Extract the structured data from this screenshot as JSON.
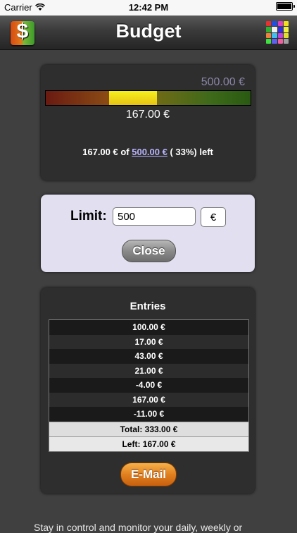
{
  "status_bar": {
    "carrier": "Carrier",
    "time": "12:42 PM"
  },
  "navbar": {
    "title": "Budget",
    "app_icon_glyph": "$",
    "grid_colors": [
      "#e83030",
      "#2050e0",
      "#e040c0",
      "#f0e020",
      "#30b030",
      "#f0f0f0",
      "#3030e0",
      "#f0f040",
      "#f08040",
      "#40c0f0",
      "#c040e0",
      "#e0e030",
      "#40e040",
      "#6060f0",
      "#f060a0",
      "#a0a0a0"
    ]
  },
  "budget": {
    "max_label": "500.00 €",
    "spent_label": "167.00 €",
    "spent_fraction": 0.334,
    "summary_prefix": "167.00 € of ",
    "summary_link": "500.00 €",
    "summary_suffix": " ( 33%) left"
  },
  "limit": {
    "label": "Limit:",
    "value": "500",
    "currency": "€",
    "close_label": "Close"
  },
  "entries": {
    "title": "Entries",
    "items": [
      "100.00 €",
      "17.00 €",
      "43.00 €",
      "21.00 €",
      "-4.00 €",
      "167.00 €",
      "-11.00 €"
    ],
    "total": "Total: 333.00 €",
    "left": "Left: 167.00 €",
    "email_label": "E-Mail"
  },
  "footer": {
    "text": "Stay in control and monitor your daily, weekly or"
  }
}
